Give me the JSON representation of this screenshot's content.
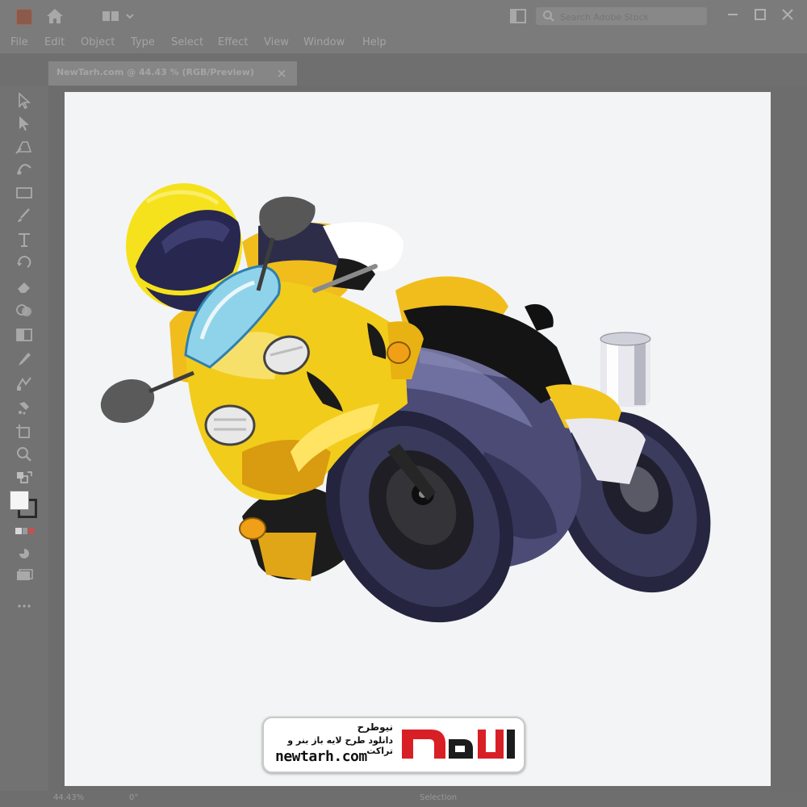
{
  "menu": [
    "File",
    "Edit",
    "Object",
    "Type",
    "Select",
    "Effect",
    "View",
    "Window",
    "Help"
  ],
  "search": {
    "placeholder": "Search Adobe Stock"
  },
  "document_tab": {
    "title": "NewTarh.com @ 44.43 % (RGB/Preview)",
    "close": "×"
  },
  "status": {
    "zoom": "44.43%",
    "rotation": "0°",
    "tool": "Selection"
  },
  "watermark": {
    "line1": "نیوطرح",
    "line2": "دانلود طرح لایه باز بنر و تراکت",
    "url": "newtarh.com",
    "logo_text": "نیوطرح"
  },
  "colors": {
    "chrome": "#7b7b7b",
    "artboard": "#f3f4f5",
    "fairing_yellow": "#f2cc1b",
    "body_purple": "#55557e",
    "logo_red": "#d91f26"
  },
  "icons": [
    "home-icon",
    "layout-icon",
    "arrange-icon",
    "search-icon",
    "minimize-icon",
    "maximize-icon",
    "close-icon",
    "selection-tool-icon",
    "direct-selection-tool-icon",
    "pen-tool-icon",
    "curvature-tool-icon",
    "rectangle-tool-icon",
    "brush-tool-icon",
    "type-tool-icon",
    "rotate-tool-icon",
    "eraser-tool-icon",
    "shape-builder-icon",
    "gradient-tool-icon",
    "eyedropper-tool-icon",
    "blend-tool-icon",
    "symbol-sprayer-icon",
    "artboard-tool-icon",
    "hand-tool-icon",
    "zoom-tool-icon",
    "fill-stroke-icon",
    "drawing-modes-icon",
    "screen-mode-icon"
  ]
}
